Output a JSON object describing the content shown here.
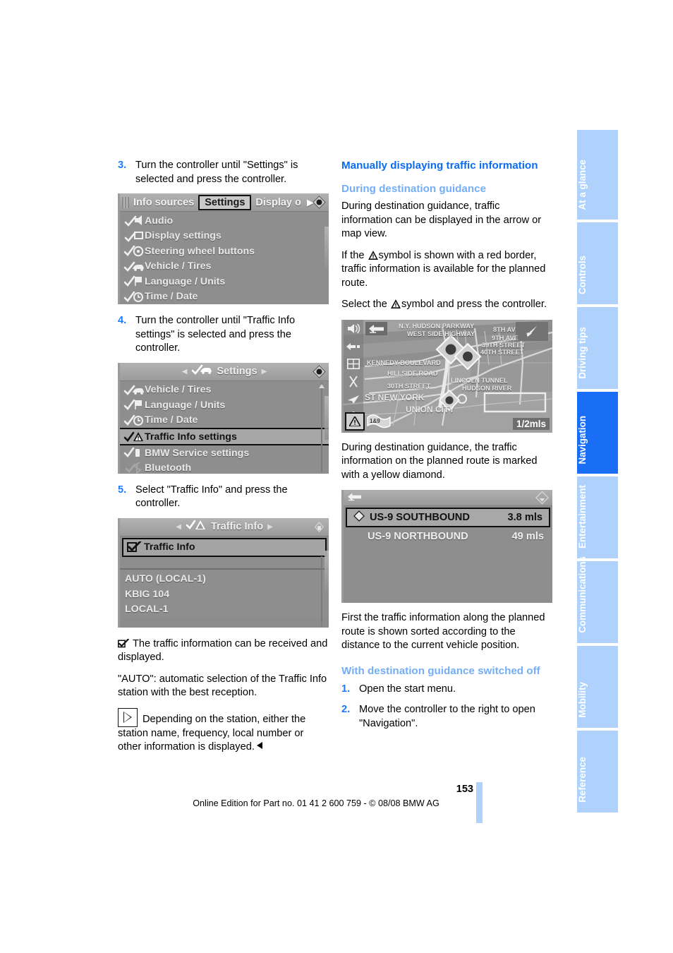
{
  "left_column": {
    "steps": [
      {
        "num": "3.",
        "text": "Turn the controller until \"Settings\" is selected and press the controller."
      },
      {
        "num": "4.",
        "text": "Turn the controller until \"Traffic Info settings\" is selected and press the controller."
      },
      {
        "num": "5.",
        "text": "Select \"Traffic Info\" and press the controller."
      }
    ],
    "notes": {
      "checkbox_note": "The traffic information can be received and displayed.",
      "auto_note": "\"AUTO\": automatic selection of the Traffic Info station with the best reception.",
      "play_note": "Depending on the station, either the station name, frequency, local number or other information is displayed."
    }
  },
  "screenshot_settings": {
    "tabs": [
      {
        "label": "Info sources",
        "selected": false
      },
      {
        "label": "Settings",
        "selected": true
      },
      {
        "label": "Display o",
        "selected": false
      }
    ],
    "items": [
      {
        "label": "Audio",
        "icon": "audio-icon"
      },
      {
        "label": "Display settings",
        "icon": "display-icon"
      },
      {
        "label": "Steering wheel buttons",
        "icon": "steering-wheel-icon"
      },
      {
        "label": "Vehicle / Tires",
        "icon": "vehicle-icon"
      },
      {
        "label": "Language / Units",
        "icon": "flag-icon"
      },
      {
        "label": "Time / Date",
        "icon": "clock-icon"
      }
    ]
  },
  "screenshot_settings2": {
    "title": "Settings",
    "items": [
      {
        "label": "Vehicle / Tires",
        "icon": "vehicle-icon",
        "selected": false
      },
      {
        "label": "Language / Units",
        "icon": "flag-icon",
        "selected": false
      },
      {
        "label": "Time / Date",
        "icon": "clock-icon",
        "selected": false
      },
      {
        "label": "Traffic Info settings",
        "icon": "traffic-warning-icon",
        "selected": true
      },
      {
        "label": "BMW Service settings",
        "icon": "service-icon",
        "selected": false
      },
      {
        "label": "Bluetooth",
        "icon": "bluetooth-icon",
        "selected": false
      }
    ]
  },
  "screenshot_traffic": {
    "title": "Traffic Info",
    "checkbox_row": {
      "label": "Traffic Info",
      "checked": true
    },
    "stations": [
      "AUTO (LOCAL-1)",
      "KBIG 104",
      "LOCAL-1"
    ]
  },
  "right_column": {
    "heading": "Manually displaying traffic information",
    "sub1": "During destination guidance",
    "para1": "During destination guidance, traffic information can be displayed in the arrow or map view.",
    "para2_a": "If the",
    "para2_b": "symbol is shown with a red border, traffic information is available for the planned route.",
    "para3_a": "Select the",
    "para3_b": "symbol and press the controller.",
    "para4": "During destination guidance, the traffic information on the planned route is marked with a yellow diamond.",
    "para5": "First the traffic information along the planned route is shown sorted according to the distance to the current vehicle position.",
    "sub2": "With destination guidance switched off",
    "steps": [
      {
        "num": "1.",
        "text": "Open the start menu."
      },
      {
        "num": "2.",
        "text": "Move the controller to the right to open \"Navigation\"."
      }
    ]
  },
  "screenshot_map": {
    "scale": "1/2mls",
    "labels": [
      "N.Y. HUDSON PARKWAY",
      "WEST SIDE HIGHWAY",
      "8TH AV",
      "9TH AVE",
      "39TH STREET",
      "40TH STREET",
      "KENNEDY BOULEVARD",
      "HILLSIDE ROAD",
      "LINCOLN TUNNEL",
      "HUDSON RIVER",
      "30TH STREET",
      "ST NEW YORK",
      "UNION CITY",
      "1&9"
    ]
  },
  "screenshot_list": {
    "rows": [
      {
        "name": "US-9 SOUTHBOUND",
        "distance": "3.8 mls",
        "selected": true
      },
      {
        "name": "US-9 NORTHBOUND",
        "distance": "49 mls",
        "selected": false
      }
    ]
  },
  "sidebar": {
    "tabs": [
      {
        "label": "At a glance",
        "active": false
      },
      {
        "label": "Controls",
        "active": false
      },
      {
        "label": "Driving tips",
        "active": false
      },
      {
        "label": "Navigation",
        "active": true
      },
      {
        "label": "Entertainment",
        "active": false
      },
      {
        "label": "Communications",
        "active": false
      },
      {
        "label": "Mobility",
        "active": false
      },
      {
        "label": "Reference",
        "active": false
      }
    ]
  },
  "footer": {
    "page_number": "153",
    "imprint": "Online Edition for Part no. 01 41 2 600 759 - © 08/08 BMW AG"
  },
  "colors": {
    "accent_blue": "#0a6cf0",
    "sub_blue": "#74aef6",
    "tab_blue": "#aed2fb",
    "active_tab": "#1a6ef5"
  }
}
